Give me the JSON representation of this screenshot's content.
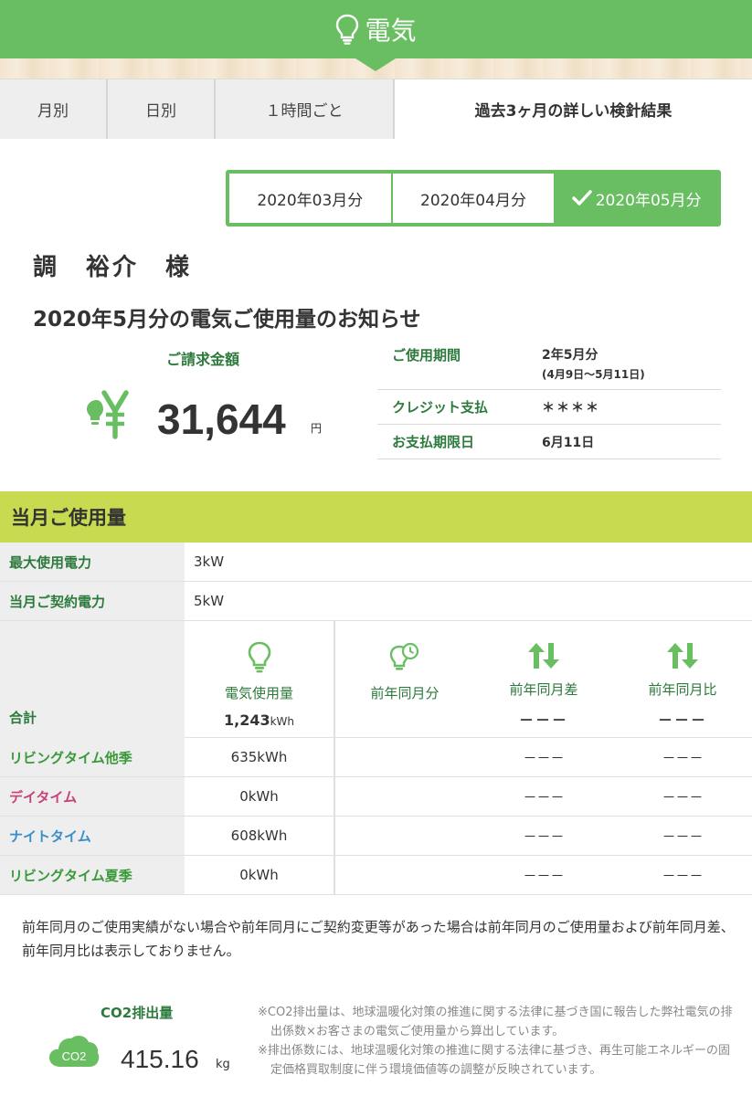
{
  "header": {
    "title": "電気"
  },
  "tabs": [
    {
      "label": "月別"
    },
    {
      "label": "日別"
    },
    {
      "label": "１時間ごと"
    },
    {
      "label": "過去3ヶ月の詳しい検針結果"
    }
  ],
  "months": [
    {
      "label": "2020年03月分"
    },
    {
      "label": "2020年04月分"
    },
    {
      "label": "2020年05月分"
    }
  ],
  "customer": {
    "name": "調　裕介　様"
  },
  "notice": {
    "title": "2020年5月分の電気ご使用量のお知らせ"
  },
  "bill": {
    "label": "ご請求金額",
    "amount": "31,644",
    "unit": "円"
  },
  "info": [
    {
      "key": "ご使用期間",
      "value": "2年5月分",
      "sub": "(4月9日～5月11日)"
    },
    {
      "key": "クレジット支払",
      "value": "＊＊＊＊",
      "sub": ""
    },
    {
      "key": "お支払期限日",
      "value": "6月11日",
      "sub": ""
    }
  ],
  "usage": {
    "section_title": "当月ご使用量",
    "max_power": {
      "label": "最大使用電力",
      "value": "3kW"
    },
    "contract_power": {
      "label": "当月ご契約電力",
      "value": "5kW"
    },
    "columns": [
      "電気使用量",
      "前年同月分",
      "前年同月差",
      "前年同月比"
    ],
    "total": {
      "label": "合計",
      "value": "1,243",
      "unit": "kWh",
      "diff": "－－－",
      "ratio": "－－－"
    },
    "rows": [
      {
        "label": "リビングタイム他季",
        "value": "635kWh",
        "diff": "－－－",
        "ratio": "－－－",
        "color": "#3a9a3a"
      },
      {
        "label": "デイタイム",
        "value": "0kWh",
        "diff": "－－－",
        "ratio": "－－－",
        "color": "#c8427a"
      },
      {
        "label": "ナイトタイム",
        "value": "608kWh",
        "diff": "－－－",
        "ratio": "－－－",
        "color": "#3a8fc8"
      },
      {
        "label": "リビングタイム夏季",
        "value": "0kWh",
        "diff": "－－－",
        "ratio": "－－－",
        "color": "#3a9a3a"
      }
    ]
  },
  "note": "前年同月のご使用実績がない場合や前年同月にご契約変更等があった場合は前年同月のご使用量および前年同月差、前年同月比は表示しておりません。",
  "co2": {
    "label": "CO2排出量",
    "icon_text": "CO2",
    "value": "415.16",
    "unit": "kg",
    "notes": [
      "※CO2排出量は、地球温暖化対策の推進に関する法律に基づき国に報告した弊社電気の排出係数×お客さまの電気ご使用量から算出しています。",
      "※排出係数には、地球温暖化対策の推進に関する法律に基づき、再生可能エネルギーの固定価格買取制度に伴う環境価値等の調整が反映されています。"
    ]
  },
  "colors": {
    "brand": "#69be62",
    "section": "#c8da4f",
    "label_green": "#2c7a3c"
  }
}
